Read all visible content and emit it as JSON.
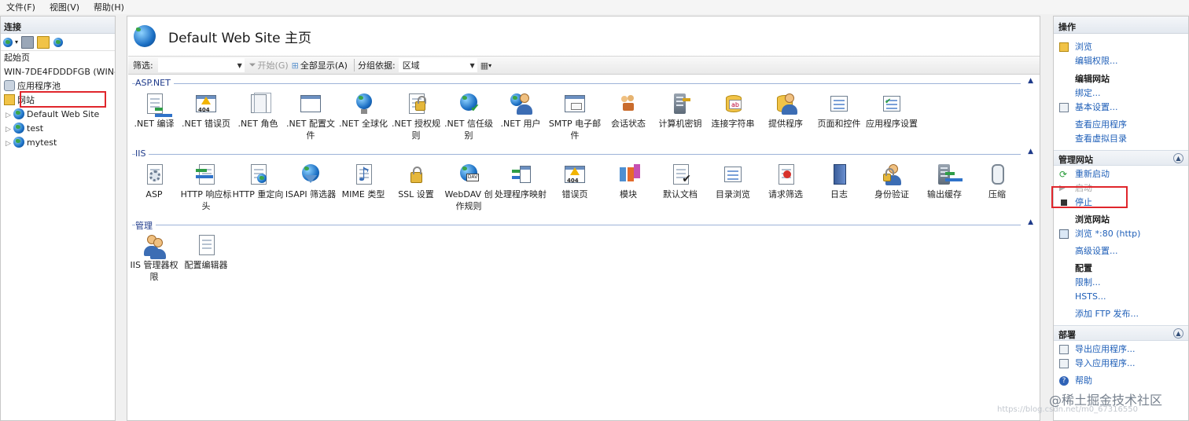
{
  "menu": {
    "file": "文件(F)",
    "view": "视图(V)",
    "help": "帮助(H)"
  },
  "left": {
    "title": "连接",
    "tree": {
      "start": "起始页",
      "server": "WIN-7DE4FDDDFGB (WIN-",
      "pools": "应用程序池",
      "sites": "网站",
      "site1": "Default Web Site",
      "site2": "test",
      "site3": "mytest"
    }
  },
  "center": {
    "title": "Default Web Site 主页",
    "filter": {
      "label": "筛选:",
      "go": "开始(G)",
      "show_all": "全部显示(A)",
      "group_label": "分组依据:",
      "group_value": "区域"
    },
    "sections": {
      "aspnet": "ASP.NET",
      "iis": "IIS",
      "manage": "管理"
    },
    "aspnet": [
      ".NET 编译",
      ".NET 错误页",
      ".NET 角色",
      ".NET 配置文件",
      ".NET 全球化",
      ".NET 授权规则",
      ".NET 信任级别",
      ".NET 用户",
      "SMTP 电子邮件",
      "会话状态",
      "计算机密钥",
      "连接字符串",
      "提供程序",
      "页面和控件",
      "应用程序设置"
    ],
    "iis": [
      "ASP",
      "HTTP 响应标头",
      "HTTP 重定向",
      "ISAPI 筛选器",
      "MIME 类型",
      "SSL 设置",
      "WebDAV 创作规则",
      "处理程序映射",
      "错误页",
      "模块",
      "默认文档",
      "目录浏览",
      "请求筛选",
      "日志",
      "身份验证",
      "输出缓存",
      "压缩"
    ],
    "manage": [
      "IIS 管理器权限",
      "配置编辑器"
    ]
  },
  "right": {
    "title": "操作",
    "browse": "浏览",
    "edit_perm": "编辑权限...",
    "edit_site": "编辑网站",
    "bindings": "绑定...",
    "basic": "基本设置...",
    "view_apps": "查看应用程序",
    "view_vdirs": "查看虚拟目录",
    "manage_site": "管理网站",
    "restart": "重新启动",
    "start": "启动",
    "stop": "停止",
    "browse_site": "浏览网站",
    "browse_80": "浏览 *:80 (http)",
    "advanced": "高级设置...",
    "config": "配置",
    "limits": "限制...",
    "hsts": "HSTS...",
    "add_ftp": "添加 FTP 发布...",
    "deploy": "部署",
    "export_app": "导出应用程序...",
    "import_app": "导入应用程序...",
    "help": "帮助"
  },
  "watermark": "@稀土掘金技术社区",
  "watermark_url": "https://blog.csdn.net/m0_67316550"
}
